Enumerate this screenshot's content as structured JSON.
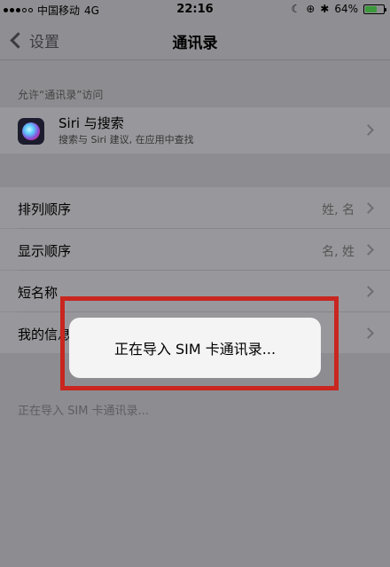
{
  "status_bar": {
    "carrier": "中国移动",
    "network": "4G",
    "time": "22:16",
    "battery_percent": "64%",
    "battery_level": 0.64
  },
  "nav": {
    "back_label": "设置",
    "title": "通讯录"
  },
  "section_header": "允许“通讯录”访问",
  "siri_cell": {
    "title": "Siri 与搜索",
    "subtitle": "搜索与 Siri 建议, 在应用中查找"
  },
  "settings": [
    {
      "label": "排列顺序",
      "value": "姓, 名"
    },
    {
      "label": "显示顺序",
      "value": "名, 姓"
    },
    {
      "label": "短名称",
      "value": ""
    },
    {
      "label": "我的信息",
      "value": ""
    }
  ],
  "import_sim_label": "正在导入 SIM 卡通讯录...",
  "popup_message": "正在导入 SIM 卡通讯录..."
}
